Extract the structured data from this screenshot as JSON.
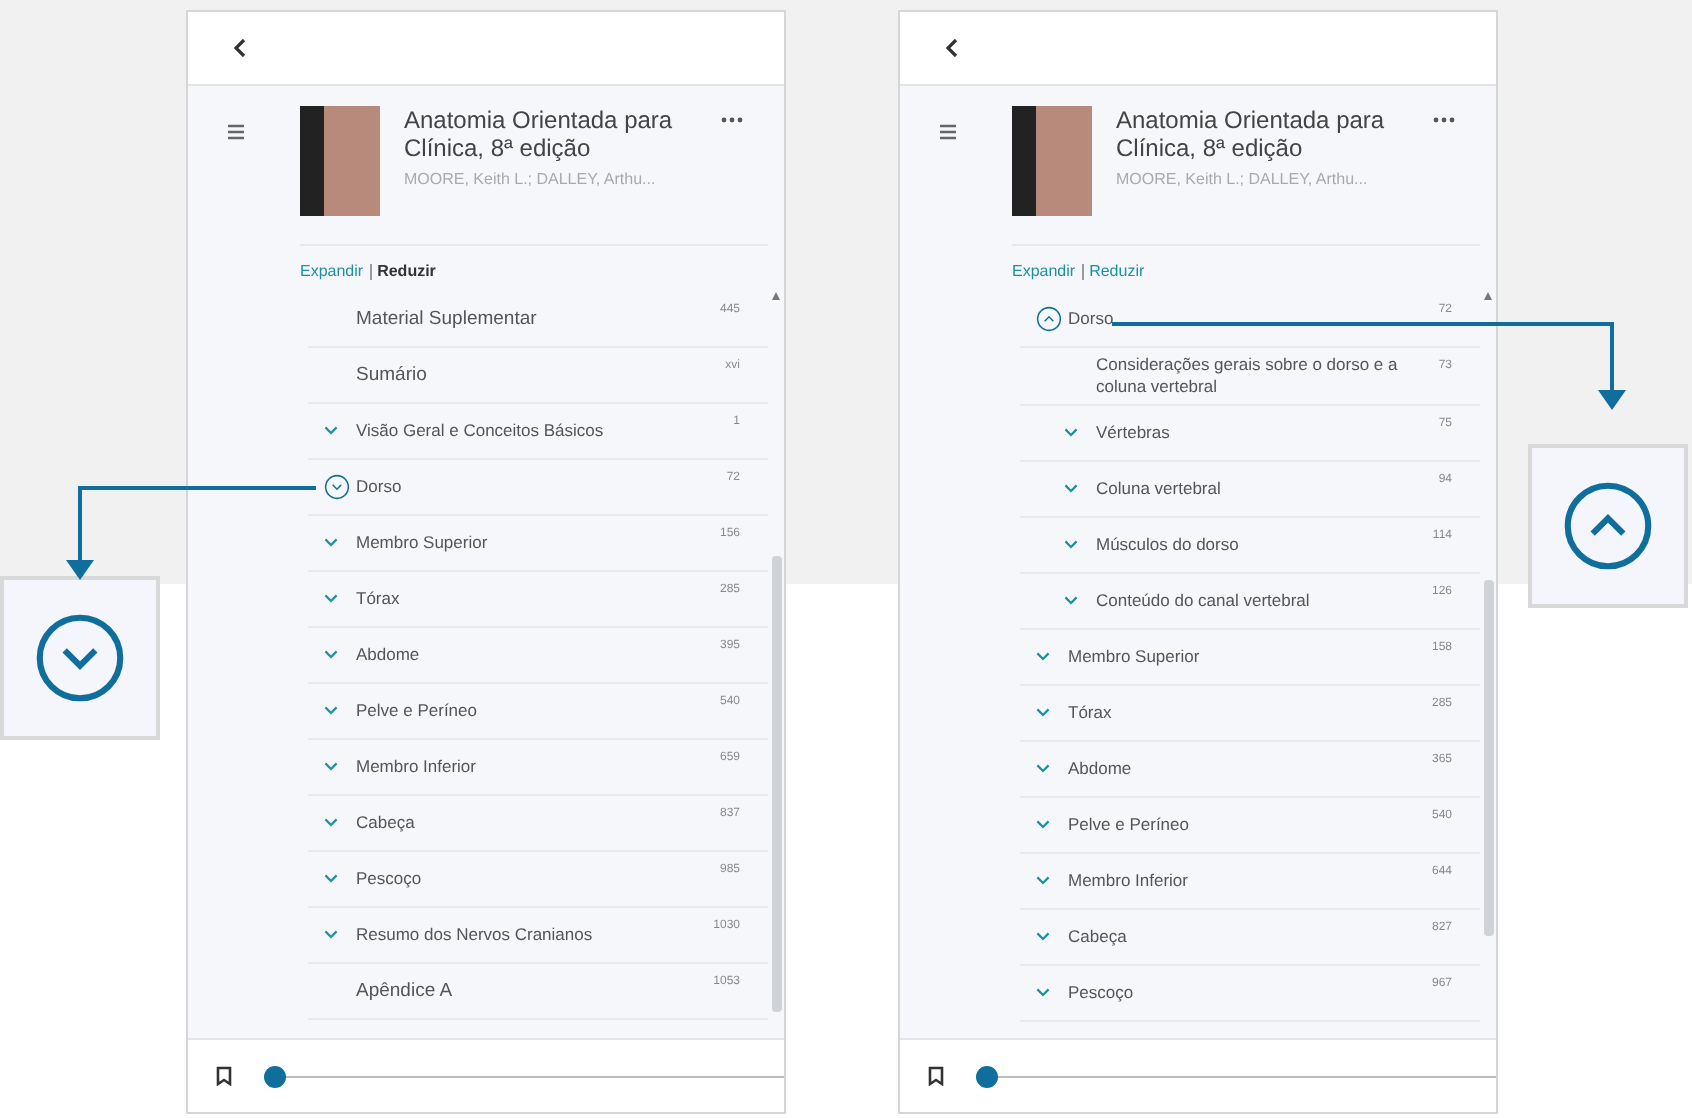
{
  "panels": [
    {
      "book": {
        "title": "Anatomia Orientada para Clínica, 8ª edição",
        "authors": "MOORE, Keith L.; DALLEY, Arthu..."
      },
      "links": [
        {
          "label": "Expandir",
          "active": false
        },
        {
          "label": "Reduzir",
          "active": true
        }
      ],
      "toc": [
        {
          "label": "Material Suplementar",
          "page": "445",
          "kind": "leaf"
        },
        {
          "label": "Sumário",
          "page": "xvi",
          "kind": "leaf"
        },
        {
          "label": "Visão Geral e Conceitos Básicos",
          "page": "1",
          "kind": "chapter",
          "expanded": false,
          "focused": false
        },
        {
          "label": "Dorso",
          "page": "72",
          "kind": "chapter",
          "expanded": false,
          "focused": true
        },
        {
          "label": "Membro Superior",
          "page": "156",
          "kind": "chapter",
          "expanded": false,
          "focused": false
        },
        {
          "label": "Tórax",
          "page": "285",
          "kind": "chapter",
          "expanded": false,
          "focused": false
        },
        {
          "label": "Abdome",
          "page": "395",
          "kind": "chapter",
          "expanded": false,
          "focused": false
        },
        {
          "label": "Pelve e Períneo",
          "page": "540",
          "kind": "chapter",
          "expanded": false,
          "focused": false
        },
        {
          "label": "Membro Inferior",
          "page": "659",
          "kind": "chapter",
          "expanded": false,
          "focused": false
        },
        {
          "label": "Cabeça",
          "page": "837",
          "kind": "chapter",
          "expanded": false,
          "focused": false
        },
        {
          "label": "Pescoço",
          "page": "985",
          "kind": "chapter",
          "expanded": false,
          "focused": false
        },
        {
          "label": "Resumo dos Nervos Cranianos",
          "page": "1030",
          "kind": "chapter",
          "expanded": false,
          "focused": false
        },
        {
          "label": "Apêndice A",
          "page": "1053",
          "kind": "leaf"
        }
      ],
      "progress": {
        "level": 0
      }
    },
    {
      "book": {
        "title": "Anatomia Orientada para Clínica, 8ª edição",
        "authors": "MOORE, Keith L.; DALLEY, Arthu..."
      },
      "links": [
        {
          "label": "Expandir",
          "active": false
        },
        {
          "label": "Reduzir",
          "active": false
        }
      ],
      "toc": [
        {
          "label": "Dorso",
          "page": "72",
          "kind": "chapter",
          "expanded": true,
          "focused": true,
          "children": [
            {
              "label": "Considerações gerais sobre o dorso e a coluna vertebral",
              "page": "73",
              "kind": "leaf"
            },
            {
              "label": "Vértebras",
              "page": "75",
              "kind": "chapter",
              "expanded": false,
              "focused": false
            },
            {
              "label": "Coluna vertebral",
              "page": "94",
              "kind": "chapter",
              "expanded": false,
              "focused": false
            },
            {
              "label": "Músculos do dorso",
              "page": "114",
              "kind": "chapter",
              "expanded": false,
              "focused": false
            },
            {
              "label": "Conteúdo do canal vertebral",
              "page": "126",
              "kind": "chapter",
              "expanded": false,
              "focused": false
            }
          ]
        },
        {
          "label": "Membro Superior",
          "page": "158",
          "kind": "chapter",
          "expanded": false,
          "focused": false
        },
        {
          "label": "Tórax",
          "page": "285",
          "kind": "chapter",
          "expanded": false,
          "focused": false
        },
        {
          "label": "Abdome",
          "page": "365",
          "kind": "chapter",
          "expanded": false,
          "focused": false
        },
        {
          "label": "Pelve e Períneo",
          "page": "540",
          "kind": "chapter",
          "expanded": false,
          "focused": false
        },
        {
          "label": "Membro Inferior",
          "page": "644",
          "kind": "chapter",
          "expanded": false,
          "focused": false
        },
        {
          "label": "Cabeça",
          "page": "827",
          "kind": "chapter",
          "expanded": false,
          "focused": false
        },
        {
          "label": "Pescoço",
          "page": "967",
          "kind": "chapter",
          "expanded": false,
          "focused": false
        }
      ],
      "progress": {
        "level": 0
      }
    }
  ],
  "callouts": [
    {
      "expanded": false
    },
    {
      "expanded": true
    }
  ]
}
